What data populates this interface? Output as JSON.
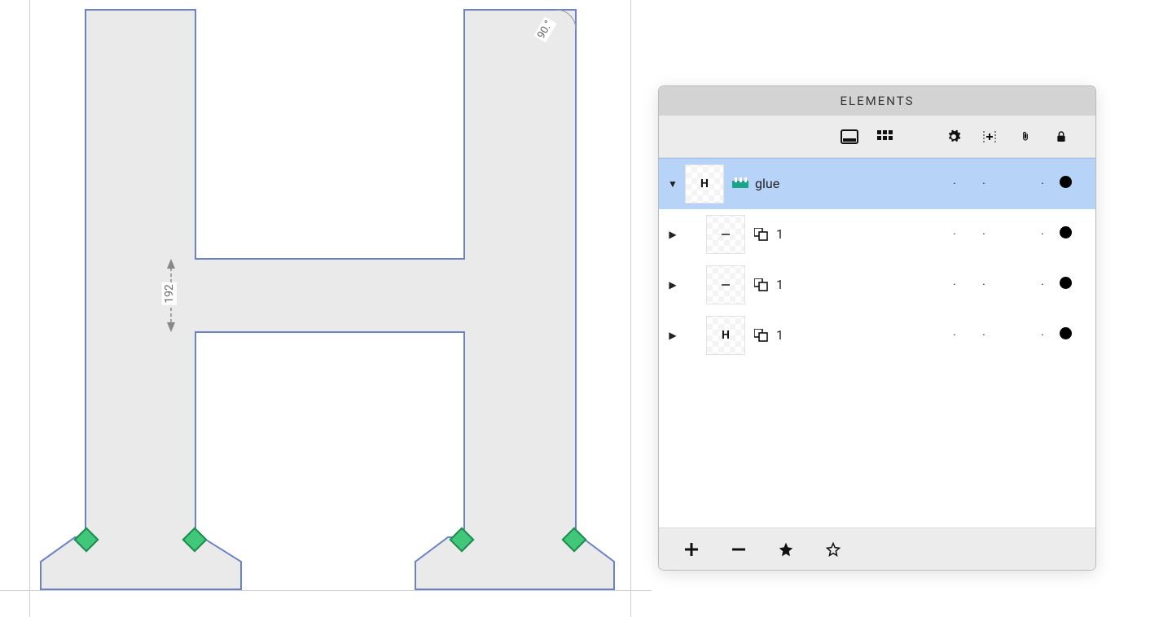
{
  "canvas": {
    "angle_annotation": "90.°",
    "dimension_annotation": "192"
  },
  "panel": {
    "title": "ELEMENTS",
    "rows": [
      {
        "expanded": true,
        "depth": 0,
        "thumb": "H",
        "type": "glue",
        "label": "glue",
        "dots": [
          "·",
          "·",
          "·"
        ],
        "filled": true
      },
      {
        "expanded": false,
        "depth": 1,
        "thumb": "dash",
        "type": "group",
        "label": "1",
        "dots": [
          "·",
          "·",
          "·"
        ],
        "filled": true
      },
      {
        "expanded": false,
        "depth": 1,
        "thumb": "dash",
        "type": "group",
        "label": "1",
        "dots": [
          "·",
          "·",
          "·"
        ],
        "filled": true
      },
      {
        "expanded": false,
        "depth": 1,
        "thumb": "H",
        "type": "group",
        "label": "1",
        "dots": [
          "·",
          "·",
          "·"
        ],
        "filled": true
      }
    ],
    "selected_index": 0
  }
}
